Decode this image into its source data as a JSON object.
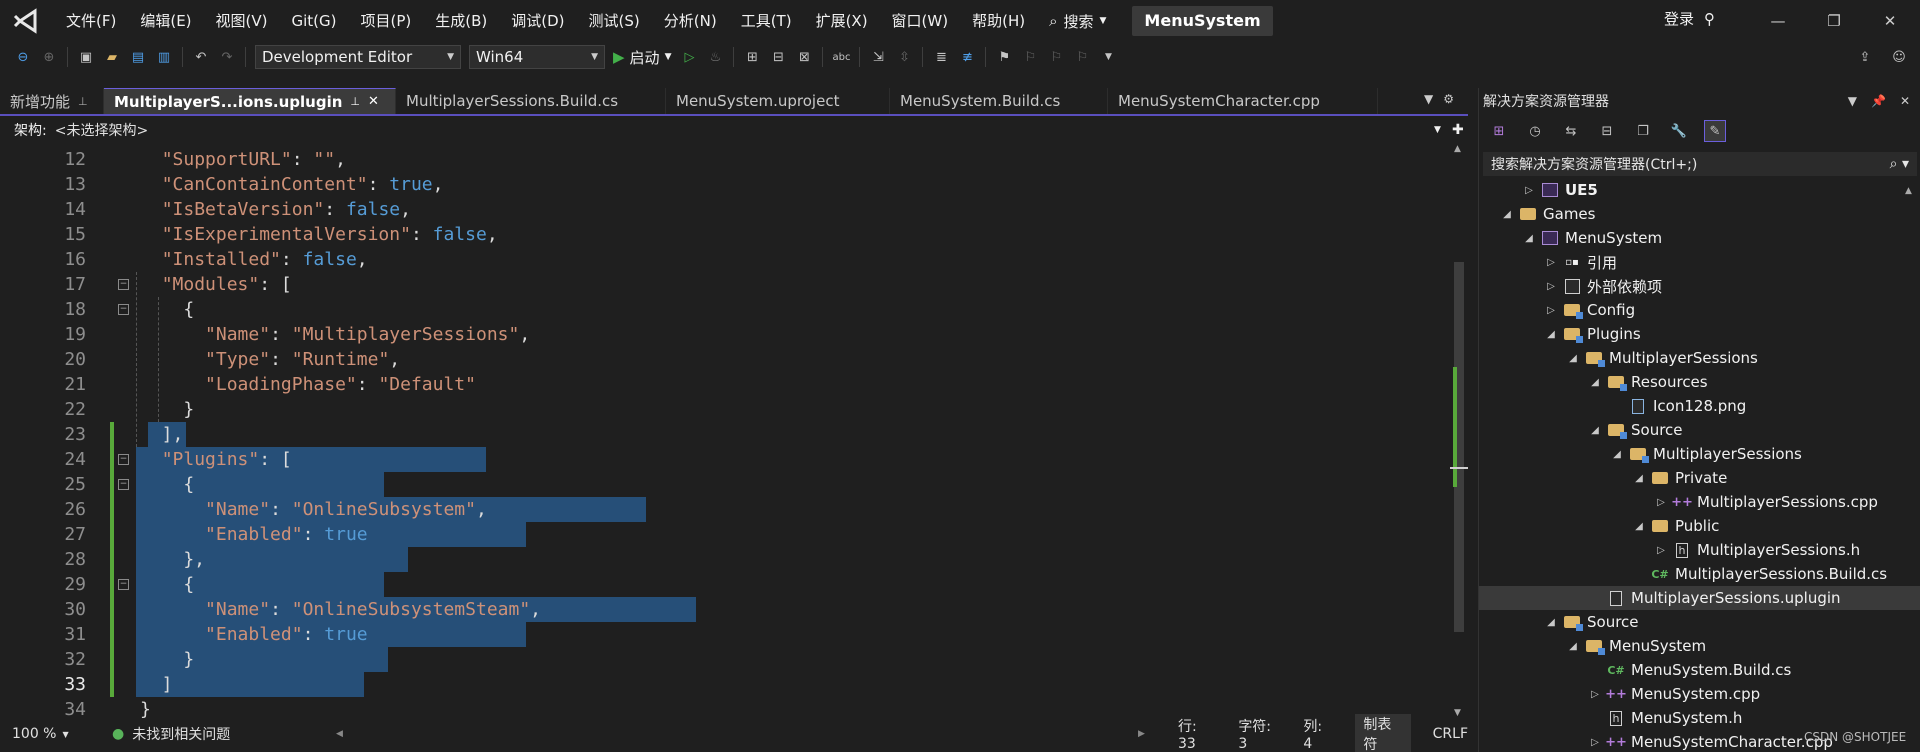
{
  "app": {
    "project_name": "MenuSystem",
    "login": "登录"
  },
  "menu": [
    "文件(F)",
    "编辑(E)",
    "视图(V)",
    "Git(G)",
    "项目(P)",
    "生成(B)",
    "调试(D)",
    "测试(S)",
    "分析(N)",
    "工具(T)",
    "扩展(X)",
    "窗口(W)",
    "帮助(H)"
  ],
  "search": {
    "label": "搜索"
  },
  "toolbar": {
    "config": "Development Editor",
    "platform": "Win64",
    "start": "启动"
  },
  "tabs": [
    {
      "label": "新增功能",
      "pin": "📌",
      "active": false
    },
    {
      "label": "MultiplayerS...ions.uplugin",
      "active": true
    },
    {
      "label": "MultiplayerSessions.Build.cs",
      "active": false
    },
    {
      "label": "MenuSystem.uproject",
      "active": false
    },
    {
      "label": "MenuSystem.Build.cs",
      "active": false
    },
    {
      "label": "MenuSystemCharacter.cpp",
      "active": false
    }
  ],
  "navbar": {
    "label": "架构:",
    "value": "<未选择架构>"
  },
  "editor": {
    "lines": [
      {
        "n": "12",
        "text": "  \"SupportURL\": \"\","
      },
      {
        "n": "13",
        "text": "  \"CanContainContent\": true,"
      },
      {
        "n": "14",
        "text": "  \"IsBetaVersion\": false,"
      },
      {
        "n": "15",
        "text": "  \"IsExperimentalVersion\": false,"
      },
      {
        "n": "16",
        "text": "  \"Installed\": false,"
      },
      {
        "n": "17",
        "text": "  \"Modules\": ["
      },
      {
        "n": "18",
        "text": "    {"
      },
      {
        "n": "19",
        "text": "      \"Name\": \"MultiplayerSessions\","
      },
      {
        "n": "20",
        "text": "      \"Type\": \"Runtime\","
      },
      {
        "n": "21",
        "text": "      \"LoadingPhase\": \"Default\""
      },
      {
        "n": "22",
        "text": "    }"
      },
      {
        "n": "23",
        "text": "  ],"
      },
      {
        "n": "24",
        "text": "  \"Plugins\": ["
      },
      {
        "n": "25",
        "text": "    {"
      },
      {
        "n": "26",
        "text": "      \"Name\": \"OnlineSubsystem\","
      },
      {
        "n": "27",
        "text": "      \"Enabled\": true"
      },
      {
        "n": "28",
        "text": "    },"
      },
      {
        "n": "29",
        "text": "    {"
      },
      {
        "n": "30",
        "text": "      \"Name\": \"OnlineSubsystemSteam\","
      },
      {
        "n": "31",
        "text": "      \"Enabled\": true"
      },
      {
        "n": "32",
        "text": "    }"
      },
      {
        "n": "33",
        "text": "  ]"
      },
      {
        "n": "34",
        "text": "}"
      }
    ],
    "current_line": "33"
  },
  "status": {
    "zoom": "100 %",
    "issues": "未找到相关问题",
    "row": "行: 33",
    "char": "字符: 3",
    "col": "列: 4",
    "tabs": "制表符",
    "eol": "CRLF"
  },
  "solution_explorer": {
    "title": "解决方案资源管理器",
    "search_placeholder": "搜索解决方案资源管理器(Ctrl+;)",
    "tree": [
      {
        "label": "UE5",
        "icon": "solution-project",
        "level": 1,
        "expanded": false,
        "bold": true
      },
      {
        "label": "Games",
        "icon": "folder",
        "level": 0,
        "expanded": true
      },
      {
        "label": "MenuSystem",
        "icon": "solution-project",
        "level": 1,
        "expanded": true
      },
      {
        "label": "引用",
        "icon": "references",
        "level": 2,
        "expanded": false
      },
      {
        "label": "外部依赖项",
        "icon": "external-deps",
        "level": 2,
        "expanded": false
      },
      {
        "label": "Config",
        "icon": "folder-pkg",
        "level": 2,
        "expanded": false
      },
      {
        "label": "Plugins",
        "icon": "folder-pkg",
        "level": 2,
        "expanded": true
      },
      {
        "label": "MultiplayerSessions",
        "icon": "folder-pkg",
        "level": 3,
        "expanded": true
      },
      {
        "label": "Resources",
        "icon": "folder-pkg",
        "level": 4,
        "expanded": true
      },
      {
        "label": "Icon128.png",
        "icon": "image-file",
        "level": 5,
        "expanded": null
      },
      {
        "label": "Source",
        "icon": "folder-pkg",
        "level": 4,
        "expanded": true
      },
      {
        "label": "MultiplayerSessions",
        "icon": "folder-pkg",
        "level": 5,
        "expanded": true
      },
      {
        "label": "Private",
        "icon": "folder",
        "level": 6,
        "expanded": true
      },
      {
        "label": "MultiplayerSessions.cpp",
        "icon": "cpp-file",
        "level": 7,
        "expanded": false
      },
      {
        "label": "Public",
        "icon": "folder",
        "level": 6,
        "expanded": true
      },
      {
        "label": "MultiplayerSessions.h",
        "icon": "h-file",
        "level": 7,
        "expanded": false
      },
      {
        "label": "MultiplayerSessions.Build.cs",
        "icon": "cs-file",
        "level": 6,
        "expanded": null
      },
      {
        "label": "MultiplayerSessions.uplugin",
        "icon": "file",
        "level": 4,
        "expanded": null,
        "selected": true
      },
      {
        "label": "Source",
        "icon": "folder-pkg",
        "level": 2,
        "expanded": true
      },
      {
        "label": "MenuSystem",
        "icon": "folder-pkg",
        "level": 3,
        "expanded": true
      },
      {
        "label": "MenuSystem.Build.cs",
        "icon": "cs-file",
        "level": 4,
        "expanded": null
      },
      {
        "label": "MenuSystem.cpp",
        "icon": "cpp-file",
        "level": 4,
        "expanded": false
      },
      {
        "label": "MenuSystem.h",
        "icon": "h-file",
        "level": 4,
        "expanded": null
      },
      {
        "label": "MenuSystemCharacter.cpp",
        "icon": "cpp-file",
        "level": 4,
        "expanded": false
      }
    ]
  },
  "watermark": "CSDN @SHOTJEE",
  "colors": {
    "accent": "#5a4fbd",
    "selection": "#264f78",
    "string": "#ce9178",
    "keyword": "#569cd6",
    "change_bar": "#58a93a"
  }
}
